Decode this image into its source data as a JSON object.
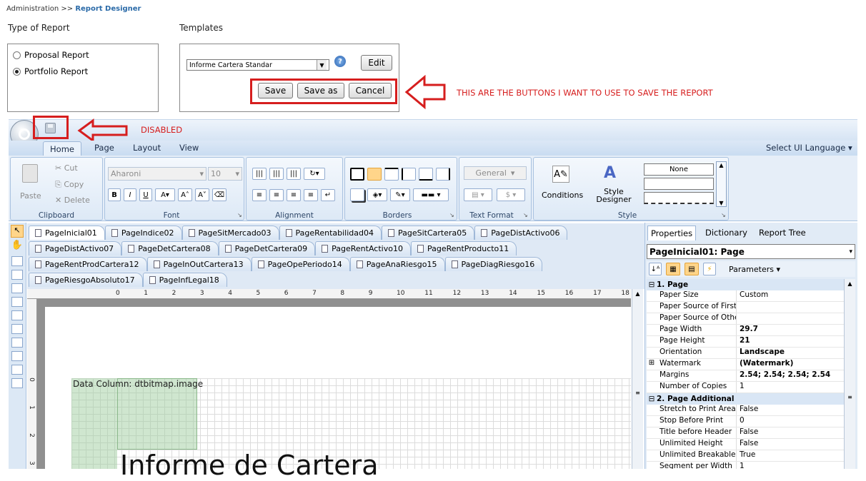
{
  "breadcrumb": {
    "parent": "Administration",
    "sep": ">>",
    "current": "Report Designer"
  },
  "type_of_report": {
    "label": "Type of Report",
    "options": [
      {
        "label": "Proposal Report",
        "selected": false
      },
      {
        "label": "Portfolio Report",
        "selected": true
      }
    ]
  },
  "templates": {
    "label": "Templates",
    "selected": "Informe Cartera Standar",
    "help": "?",
    "edit_label": "Edit",
    "save_label": "Save",
    "save_as_label": "Save as",
    "cancel_label": "Cancel"
  },
  "annotations": {
    "buttons_note": "THIS ARE THE BUTTONS I WANT TO USE TO SAVE THE REPORT",
    "disabled_note": "DISABLED",
    "color": "#d61e1e"
  },
  "ribbon": {
    "tabs": [
      "Home",
      "Page",
      "Layout",
      "View"
    ],
    "active_tab": "Home",
    "language": "Select UI Language",
    "clipboard": {
      "paste": "Paste",
      "cut": "Cut",
      "copy": "Copy",
      "delete": "Delete",
      "title": "Clipboard"
    },
    "font": {
      "family": "Aharoni",
      "size": "10",
      "title": "Font"
    },
    "alignment": {
      "title": "Alignment"
    },
    "borders": {
      "title": "Borders"
    },
    "text_format": {
      "value": "General",
      "title": "Text Format"
    },
    "style": {
      "conditions": "Conditions",
      "style_designer_1": "Style",
      "style_designer_2": "Designer",
      "none": "None",
      "title": "Style"
    }
  },
  "page_tabs": [
    [
      "PageInicial01",
      "PageIndice02",
      "PageSitMercado03",
      "PageRentabilidad04",
      "PageSitCartera05",
      "PageDistActivo06"
    ],
    [
      "PageDistActivo07",
      "PageDetCartera08",
      "PageDetCartera09",
      "PageRentActivo10",
      "PageRentProducto11"
    ],
    [
      "PageRentProdCartera12",
      "PageInOutCartera13",
      "PageOpePeriodo14",
      "PageAnaRiesgo15",
      "PageDiagRiesgo16"
    ],
    [
      "PageRiesgoAbsoluto17",
      "PageInfLegal18"
    ]
  ],
  "ruler": {
    "marks": [
      "0",
      "1",
      "2",
      "3",
      "4",
      "5",
      "6",
      "7",
      "8",
      "9",
      "10",
      "11",
      "12",
      "13",
      "14",
      "15",
      "16",
      "17",
      "18"
    ],
    "vmarks": [
      "0",
      "1",
      "2",
      "3"
    ]
  },
  "canvas": {
    "data_column": "Data Column: dtbitmap.image",
    "heading": "Informe de Cartera"
  },
  "panel": {
    "tabs": [
      "Properties",
      "Dictionary",
      "Report Tree"
    ],
    "object": "PageInicial01: Page",
    "parameters": "Parameters",
    "categories": [
      {
        "name": "1. Page",
        "rows": [
          {
            "k": "Paper Size",
            "v": "Custom",
            "b": false
          },
          {
            "k": "Paper Source of First F",
            "v": "",
            "b": false
          },
          {
            "k": "Paper Source of Other",
            "v": "",
            "b": false
          },
          {
            "k": "Page Width",
            "v": "29.7",
            "b": true
          },
          {
            "k": "Page Height",
            "v": "21",
            "b": true
          },
          {
            "k": "Orientation",
            "v": "Landscape",
            "b": true
          },
          {
            "k": "Watermark",
            "v": "(Watermark)",
            "b": true
          },
          {
            "k": "Margins",
            "v": "2.54; 2.54; 2.54; 2.54",
            "b": true
          },
          {
            "k": "Number of Copies",
            "v": "1",
            "b": false
          }
        ]
      },
      {
        "name": "2. Page Additional",
        "rows": [
          {
            "k": "Stretch to Print Area",
            "v": "False",
            "b": false
          },
          {
            "k": "Stop Before Print",
            "v": "0",
            "b": false
          },
          {
            "k": "Title before Header",
            "v": "False",
            "b": false
          },
          {
            "k": "Unlimited Height",
            "v": "False",
            "b": false
          },
          {
            "k": "Unlimited Breakable",
            "v": "True",
            "b": false
          },
          {
            "k": "Segment per Width",
            "v": "1",
            "b": false
          }
        ]
      }
    ]
  }
}
